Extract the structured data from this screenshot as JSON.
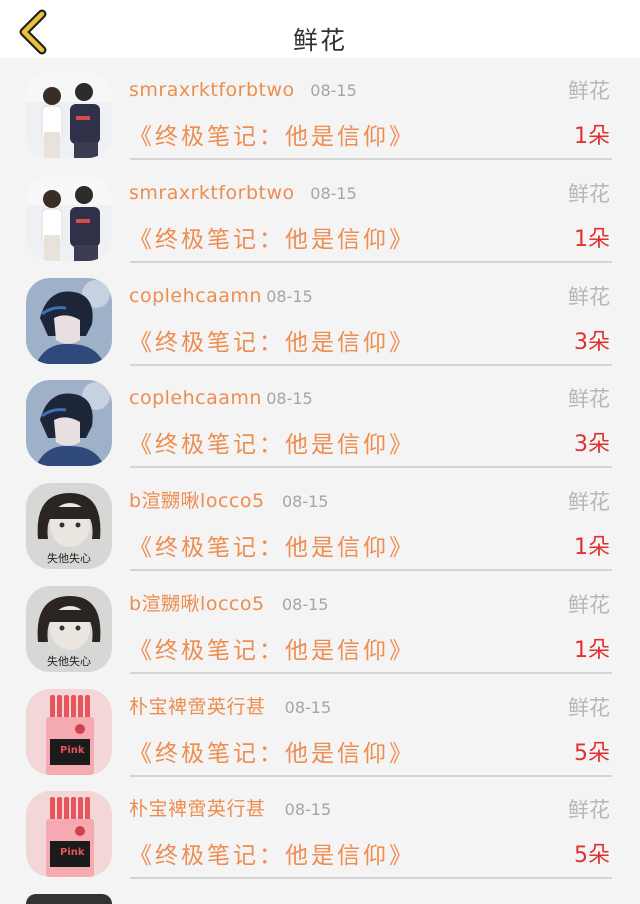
{
  "header": {
    "title": "鲜花",
    "back_icon": "chevron-left-icon",
    "back_color": "#e8c23a"
  },
  "colors": {
    "username": "#ed8d50",
    "book": "#ed8d50",
    "count": "#e0302f",
    "muted": "#a5a5a5"
  },
  "rows": [
    {
      "avatar": "couple-photo",
      "user": "smraxrktforbtwo",
      "date": "08-15",
      "type": "鲜花",
      "book": "《终极笔记：他是信仰》",
      "count": "1朵"
    },
    {
      "avatar": "couple-photo",
      "user": "smraxrktforbtwo",
      "date": "08-15",
      "type": "鲜花",
      "book": "《终极笔记：他是信仰》",
      "count": "1朵"
    },
    {
      "avatar": "anime-boy",
      "user": "coplehcaamn",
      "date": "08-15",
      "type": "鲜花",
      "book": "《终极笔记：他是信仰》",
      "count": "3朵"
    },
    {
      "avatar": "anime-boy",
      "user": "coplehcaamn",
      "date": "08-15",
      "type": "鲜花",
      "book": "《终极笔记：他是信仰》",
      "count": "3朵"
    },
    {
      "avatar": "girl-portrait",
      "avatar_caption": "失他失心",
      "user": "b渲嬲啾locco5",
      "date": "08-15",
      "type": "鲜花",
      "book": "《终极笔记：他是信仰》",
      "count": "1朵"
    },
    {
      "avatar": "girl-portrait",
      "avatar_caption": "失他失心",
      "user": "b渲嬲啾locco5",
      "date": "08-15",
      "type": "鲜花",
      "book": "《终极笔记：他是信仰》",
      "count": "1朵"
    },
    {
      "avatar": "pink-box",
      "avatar_caption": "Pink",
      "user": "朴宝裨啻英行甚",
      "date": "08-15",
      "type": "鲜花",
      "book": "《终极笔记：他是信仰》",
      "count": "5朵"
    },
    {
      "avatar": "pink-box",
      "avatar_caption": "Pink",
      "user": "朴宝裨啻英行甚",
      "date": "08-15",
      "type": "鲜花",
      "book": "《终极笔记：他是信仰》",
      "count": "5朵"
    }
  ]
}
